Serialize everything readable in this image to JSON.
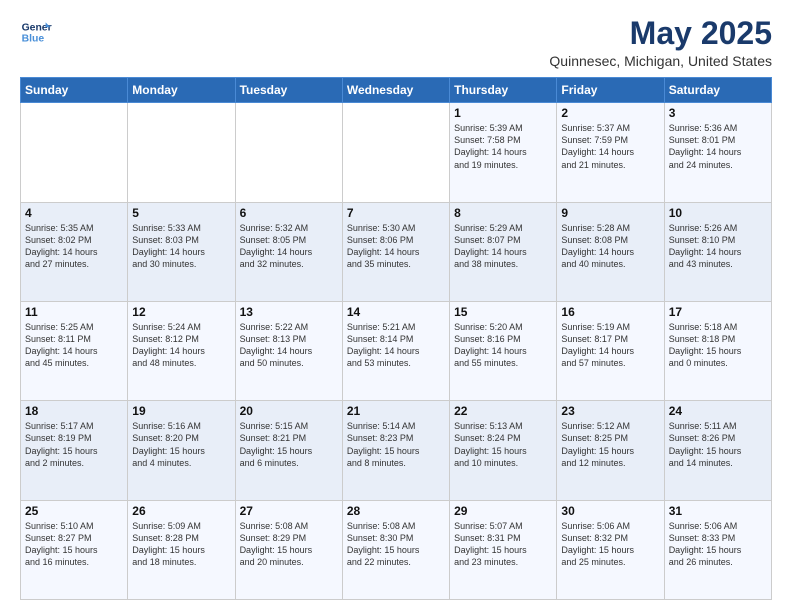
{
  "header": {
    "logo_line1": "General",
    "logo_line2": "Blue",
    "month": "May 2025",
    "location": "Quinnesec, Michigan, United States"
  },
  "weekdays": [
    "Sunday",
    "Monday",
    "Tuesday",
    "Wednesday",
    "Thursday",
    "Friday",
    "Saturday"
  ],
  "weeks": [
    [
      {
        "day": "",
        "text": ""
      },
      {
        "day": "",
        "text": ""
      },
      {
        "day": "",
        "text": ""
      },
      {
        "day": "",
        "text": ""
      },
      {
        "day": "1",
        "text": "Sunrise: 5:39 AM\nSunset: 7:58 PM\nDaylight: 14 hours\nand 19 minutes."
      },
      {
        "day": "2",
        "text": "Sunrise: 5:37 AM\nSunset: 7:59 PM\nDaylight: 14 hours\nand 21 minutes."
      },
      {
        "day": "3",
        "text": "Sunrise: 5:36 AM\nSunset: 8:01 PM\nDaylight: 14 hours\nand 24 minutes."
      }
    ],
    [
      {
        "day": "4",
        "text": "Sunrise: 5:35 AM\nSunset: 8:02 PM\nDaylight: 14 hours\nand 27 minutes."
      },
      {
        "day": "5",
        "text": "Sunrise: 5:33 AM\nSunset: 8:03 PM\nDaylight: 14 hours\nand 30 minutes."
      },
      {
        "day": "6",
        "text": "Sunrise: 5:32 AM\nSunset: 8:05 PM\nDaylight: 14 hours\nand 32 minutes."
      },
      {
        "day": "7",
        "text": "Sunrise: 5:30 AM\nSunset: 8:06 PM\nDaylight: 14 hours\nand 35 minutes."
      },
      {
        "day": "8",
        "text": "Sunrise: 5:29 AM\nSunset: 8:07 PM\nDaylight: 14 hours\nand 38 minutes."
      },
      {
        "day": "9",
        "text": "Sunrise: 5:28 AM\nSunset: 8:08 PM\nDaylight: 14 hours\nand 40 minutes."
      },
      {
        "day": "10",
        "text": "Sunrise: 5:26 AM\nSunset: 8:10 PM\nDaylight: 14 hours\nand 43 minutes."
      }
    ],
    [
      {
        "day": "11",
        "text": "Sunrise: 5:25 AM\nSunset: 8:11 PM\nDaylight: 14 hours\nand 45 minutes."
      },
      {
        "day": "12",
        "text": "Sunrise: 5:24 AM\nSunset: 8:12 PM\nDaylight: 14 hours\nand 48 minutes."
      },
      {
        "day": "13",
        "text": "Sunrise: 5:22 AM\nSunset: 8:13 PM\nDaylight: 14 hours\nand 50 minutes."
      },
      {
        "day": "14",
        "text": "Sunrise: 5:21 AM\nSunset: 8:14 PM\nDaylight: 14 hours\nand 53 minutes."
      },
      {
        "day": "15",
        "text": "Sunrise: 5:20 AM\nSunset: 8:16 PM\nDaylight: 14 hours\nand 55 minutes."
      },
      {
        "day": "16",
        "text": "Sunrise: 5:19 AM\nSunset: 8:17 PM\nDaylight: 14 hours\nand 57 minutes."
      },
      {
        "day": "17",
        "text": "Sunrise: 5:18 AM\nSunset: 8:18 PM\nDaylight: 15 hours\nand 0 minutes."
      }
    ],
    [
      {
        "day": "18",
        "text": "Sunrise: 5:17 AM\nSunset: 8:19 PM\nDaylight: 15 hours\nand 2 minutes."
      },
      {
        "day": "19",
        "text": "Sunrise: 5:16 AM\nSunset: 8:20 PM\nDaylight: 15 hours\nand 4 minutes."
      },
      {
        "day": "20",
        "text": "Sunrise: 5:15 AM\nSunset: 8:21 PM\nDaylight: 15 hours\nand 6 minutes."
      },
      {
        "day": "21",
        "text": "Sunrise: 5:14 AM\nSunset: 8:23 PM\nDaylight: 15 hours\nand 8 minutes."
      },
      {
        "day": "22",
        "text": "Sunrise: 5:13 AM\nSunset: 8:24 PM\nDaylight: 15 hours\nand 10 minutes."
      },
      {
        "day": "23",
        "text": "Sunrise: 5:12 AM\nSunset: 8:25 PM\nDaylight: 15 hours\nand 12 minutes."
      },
      {
        "day": "24",
        "text": "Sunrise: 5:11 AM\nSunset: 8:26 PM\nDaylight: 15 hours\nand 14 minutes."
      }
    ],
    [
      {
        "day": "25",
        "text": "Sunrise: 5:10 AM\nSunset: 8:27 PM\nDaylight: 15 hours\nand 16 minutes."
      },
      {
        "day": "26",
        "text": "Sunrise: 5:09 AM\nSunset: 8:28 PM\nDaylight: 15 hours\nand 18 minutes."
      },
      {
        "day": "27",
        "text": "Sunrise: 5:08 AM\nSunset: 8:29 PM\nDaylight: 15 hours\nand 20 minutes."
      },
      {
        "day": "28",
        "text": "Sunrise: 5:08 AM\nSunset: 8:30 PM\nDaylight: 15 hours\nand 22 minutes."
      },
      {
        "day": "29",
        "text": "Sunrise: 5:07 AM\nSunset: 8:31 PM\nDaylight: 15 hours\nand 23 minutes."
      },
      {
        "day": "30",
        "text": "Sunrise: 5:06 AM\nSunset: 8:32 PM\nDaylight: 15 hours\nand 25 minutes."
      },
      {
        "day": "31",
        "text": "Sunrise: 5:06 AM\nSunset: 8:33 PM\nDaylight: 15 hours\nand 26 minutes."
      }
    ]
  ]
}
